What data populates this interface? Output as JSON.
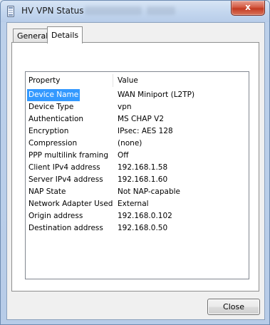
{
  "window": {
    "title": "HV VPN Status",
    "close_glyph": "x"
  },
  "tabs": [
    {
      "label": "General",
      "selected": false
    },
    {
      "label": "Details",
      "selected": true
    }
  ],
  "details": {
    "columns": [
      "Property",
      "Value"
    ],
    "rows": [
      {
        "property": "Device Name",
        "value": "WAN Miniport (L2TP)",
        "selected": true
      },
      {
        "property": "Device Type",
        "value": "vpn"
      },
      {
        "property": "Authentication",
        "value": "MS CHAP V2"
      },
      {
        "property": "Encryption",
        "value": "IPsec: AES 128"
      },
      {
        "property": "Compression",
        "value": "(none)"
      },
      {
        "property": "PPP multilink framing",
        "value": "Off"
      },
      {
        "property": "Client IPv4 address",
        "value": "192.168.1.58"
      },
      {
        "property": "Server IPv4 address",
        "value": "192.168.1.60"
      },
      {
        "property": "NAP State",
        "value": "Not NAP-capable"
      },
      {
        "property": "Network Adapter Used",
        "value": "External"
      },
      {
        "property": "Origin address",
        "value": "192.168.0.102"
      },
      {
        "property": "Destination address",
        "value": "192.168.0.50"
      }
    ]
  },
  "buttons": {
    "close_label": "Close"
  },
  "colors": {
    "selection": "#3399ff",
    "close_button": "#c33b22"
  },
  "icons": {
    "title_icon": "vpn-connection-icon"
  }
}
